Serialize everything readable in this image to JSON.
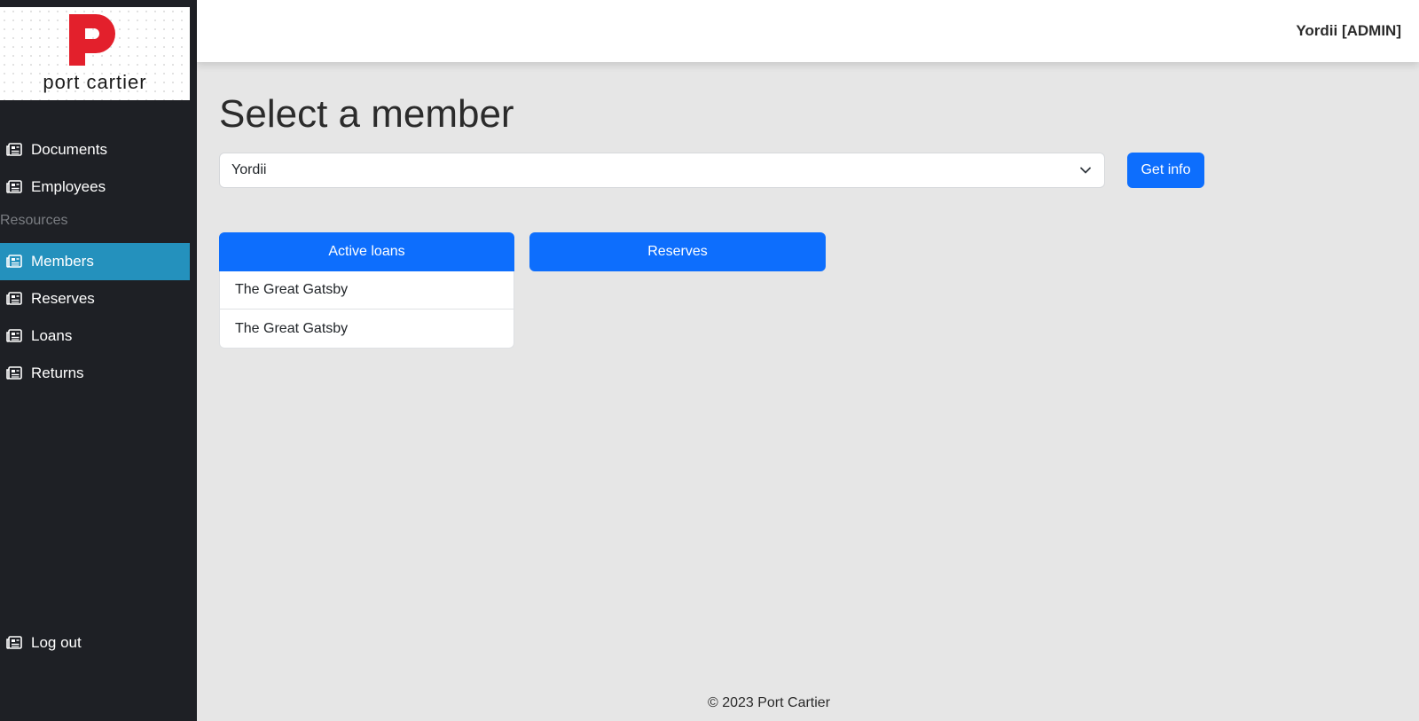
{
  "logo": {
    "text": "port cartier",
    "brand_color": "#e3202c"
  },
  "sidebar": {
    "items": [
      {
        "label": "Documents",
        "icon": "newspaper-icon"
      },
      {
        "label": "Employees",
        "icon": "newspaper-icon"
      }
    ],
    "resources_heading": "Resources",
    "resource_items": [
      {
        "label": "Members",
        "icon": "newspaper-icon",
        "active": true
      },
      {
        "label": "Reserves",
        "icon": "newspaper-icon"
      },
      {
        "label": "Loans",
        "icon": "newspaper-icon"
      },
      {
        "label": "Returns",
        "icon": "newspaper-icon"
      }
    ],
    "logout": {
      "label": "Log out",
      "icon": "newspaper-icon"
    },
    "background": "#1e2025",
    "active_color": "#2491bd"
  },
  "header": {
    "user": "Yordii [ADMIN]"
  },
  "main": {
    "title": "Select a member",
    "member_select": {
      "value": "Yordii"
    },
    "get_info_label": "Get info",
    "tabs": [
      {
        "label": "Active loans"
      },
      {
        "label": "Reserves"
      }
    ],
    "active_loans": [
      "The Great Gatsby",
      "The Great Gatsby"
    ],
    "accent": "#0d6efd"
  },
  "footer": {
    "text": "© 2023 Port Cartier"
  }
}
